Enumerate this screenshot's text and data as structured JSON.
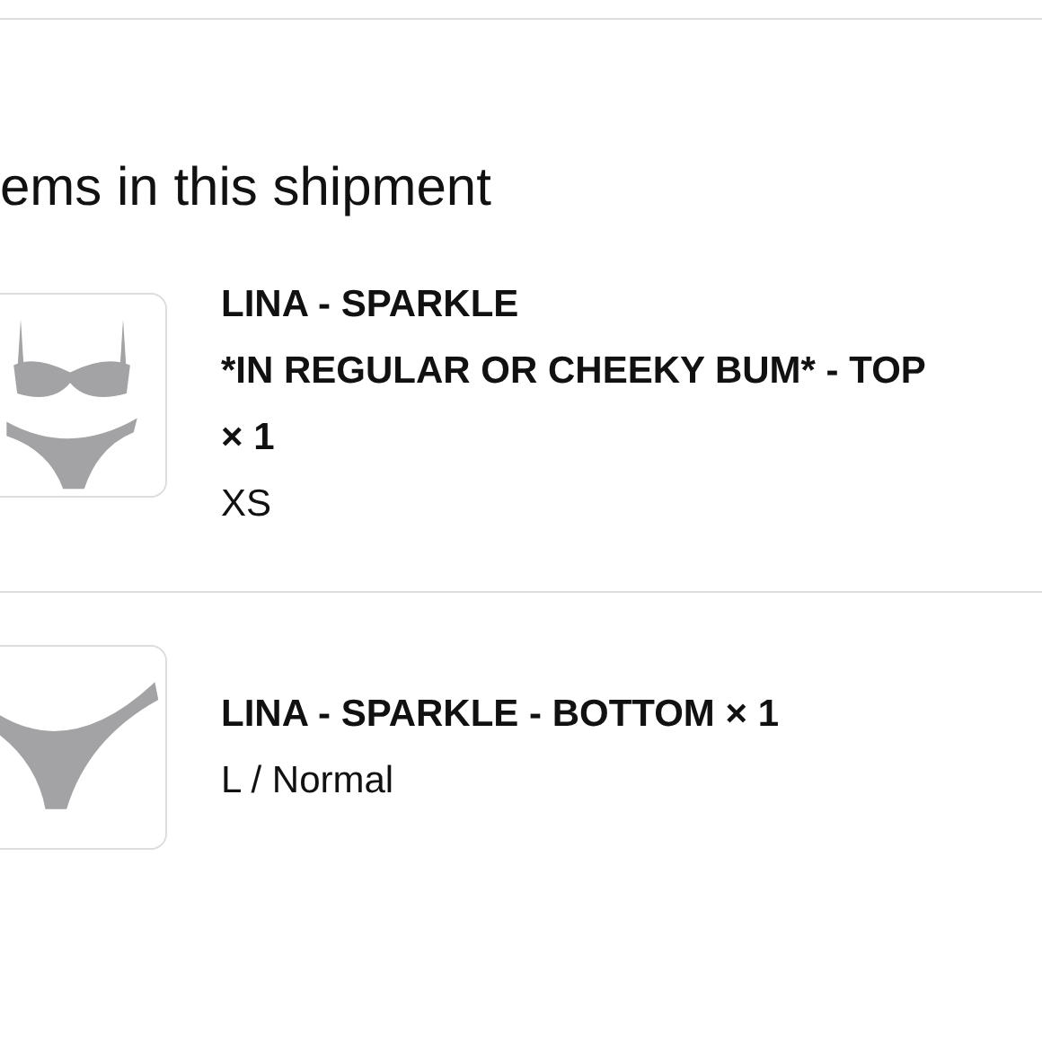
{
  "heading": "ems in this shipment",
  "items": [
    {
      "kind": "set",
      "lines": [
        "LINA - SPARKLE",
        "*IN REGULAR OR CHEEKY BUM* - TOP",
        "× 1"
      ],
      "variant": "XS"
    },
    {
      "kind": "bottom",
      "lines": [
        "LINA - SPARKLE - BOTTOM × 1"
      ],
      "variant": "L / Normal"
    }
  ]
}
